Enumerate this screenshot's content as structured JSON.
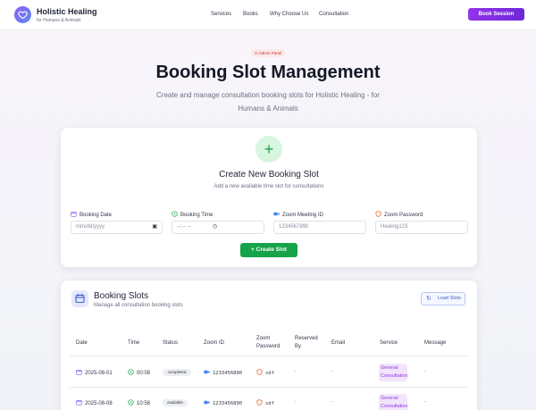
{
  "header": {
    "brand_title": "Holistic Healing",
    "brand_subtitle": "for Humans & Animals",
    "nav": [
      "Services",
      "Books",
      "Why Choose Us",
      "Consultation"
    ],
    "cta_label": "Book Session"
  },
  "hero": {
    "badge": "Admin Panel",
    "title": "Booking Slot Management",
    "subtitle": "Create and manage consultation booking slots for Holistic Healing - for Humans & Animals"
  },
  "create_form": {
    "title": "Create New Booking Slot",
    "subtitle": "Add a new available time slot for consultations",
    "fields": {
      "date": {
        "label": "Booking Date",
        "placeholder": "mm/dd/yyyy"
      },
      "time": {
        "label": "Booking Time",
        "placeholder": "--:-- --"
      },
      "zoom_id": {
        "label": "Zoom Meeting ID",
        "placeholder": "1234567890"
      },
      "zoom_password": {
        "label": "Zoom Password",
        "placeholder": "Healing123"
      }
    },
    "submit_label": "Create Slot"
  },
  "slots": {
    "title": "Booking Slots",
    "subtitle": "Manage all consultation booking slots",
    "load_label": "Load Slots",
    "columns": [
      "Date",
      "Time",
      "Status",
      "Zoom ID",
      "Zoom Password",
      "Reserved By",
      "Email",
      "Service",
      "Message"
    ],
    "rows": [
      {
        "date": "2025-08-01",
        "time": "00:08",
        "status": "completed",
        "zoom_id": "1233456890",
        "zoom_password": "sdf",
        "reserved_by": "-",
        "email": "-",
        "service": "General Consultation",
        "message": "-"
      },
      {
        "date": "2025-08-08",
        "time": "10:58",
        "status": "available",
        "zoom_id": "1233456890",
        "zoom_password": "sdf",
        "reserved_by": "-",
        "email": "-",
        "service": "General Consultation",
        "message": "-"
      }
    ]
  },
  "colors": {
    "accent_purple": "#9333ea",
    "accent_green": "#16a34a",
    "accent_blue": "#3b5bcc",
    "badge_red": "#c0392b"
  }
}
